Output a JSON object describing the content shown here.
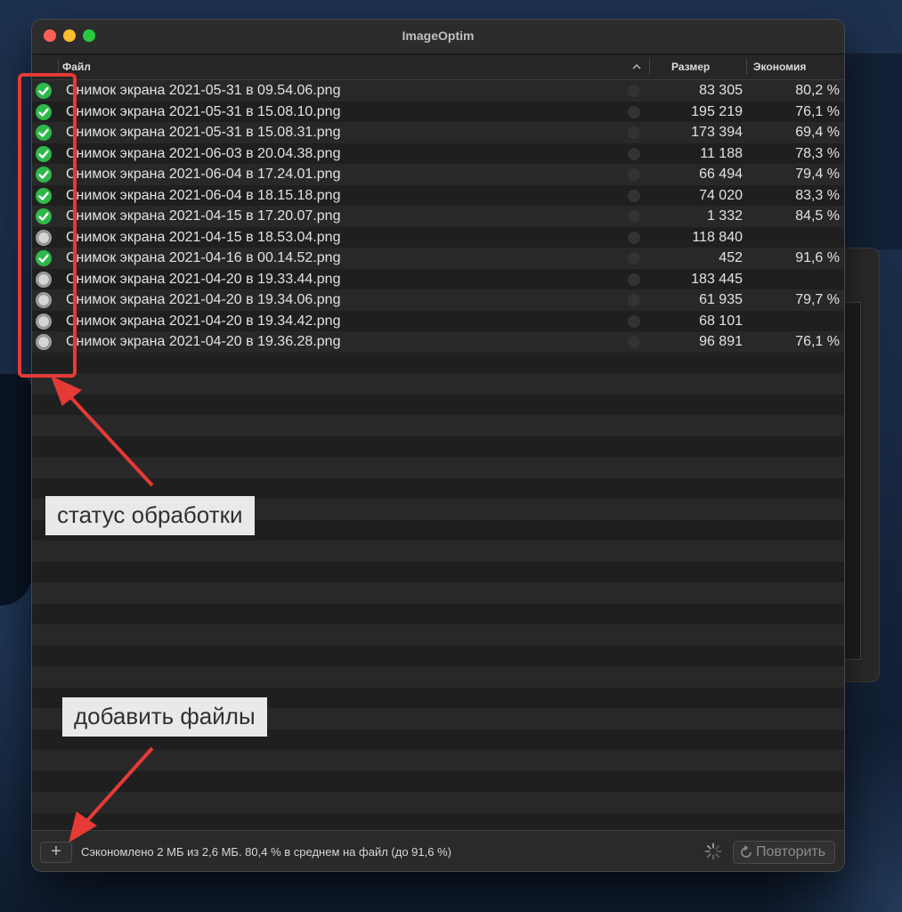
{
  "window": {
    "title": "ImageOptim"
  },
  "table": {
    "columns": {
      "file": "Файл",
      "size": "Размер",
      "savings": "Экономия"
    },
    "sort_indicator": "chevron-up-icon",
    "rows": [
      {
        "status": "done",
        "filename": "Снимок экрана 2021-05-31 в 09.54.06.png",
        "size": "83 305",
        "savings": "80,2 %"
      },
      {
        "status": "done",
        "filename": "Снимок экрана 2021-05-31 в 15.08.10.png",
        "size": "195 219",
        "savings": "76,1 %"
      },
      {
        "status": "done",
        "filename": "Снимок экрана 2021-05-31 в 15.08.31.png",
        "size": "173 394",
        "savings": "69,4 %"
      },
      {
        "status": "done",
        "filename": "Снимок экрана 2021-06-03 в 20.04.38.png",
        "size": "11 188",
        "savings": "78,3 %"
      },
      {
        "status": "done",
        "filename": "Снимок экрана 2021-06-04 в 17.24.01.png",
        "size": "66 494",
        "savings": "79,4 %"
      },
      {
        "status": "done",
        "filename": "Снимок экрана 2021-06-04 в 18.15.18.png",
        "size": "74 020",
        "savings": "83,3 %"
      },
      {
        "status": "done",
        "filename": "Снимок экрана 2021-04-15 в 17.20.07.png",
        "size": "1 332",
        "savings": "84,5 %"
      },
      {
        "status": "pending",
        "filename": "Снимок экрана 2021-04-15 в 18.53.04.png",
        "size": "118 840",
        "savings": ""
      },
      {
        "status": "done",
        "filename": "Снимок экрана 2021-04-16 в 00.14.52.png",
        "size": "452",
        "savings": "91,6 %"
      },
      {
        "status": "pending",
        "filename": "Снимок экрана 2021-04-20 в 19.33.44.png",
        "size": "183 445",
        "savings": ""
      },
      {
        "status": "pending",
        "filename": "Снимок экрана 2021-04-20 в 19.34.06.png",
        "size": "61 935",
        "savings": "79,7 %"
      },
      {
        "status": "pending",
        "filename": "Снимок экрана 2021-04-20 в 19.34.42.png",
        "size": "68 101",
        "savings": ""
      },
      {
        "status": "pending",
        "filename": "Снимок экрана 2021-04-20 в 19.36.28.png",
        "size": "96 891",
        "savings": "76,1 %"
      }
    ]
  },
  "footer": {
    "add_label": "+",
    "summary": "Сэкономлено 2 МБ из 2,6 МБ. 80,4 % в среднем на файл (до 91,6 %)",
    "retry_label": "Повторить"
  },
  "annotations": {
    "status_callout": "статус обработки",
    "add_callout": "добавить файлы"
  },
  "colors": {
    "done": "#2fb84a",
    "annotation_red": "#e53a35",
    "traffic_red": "#fe5f57",
    "traffic_yellow": "#febc2e",
    "traffic_green": "#28c840"
  }
}
